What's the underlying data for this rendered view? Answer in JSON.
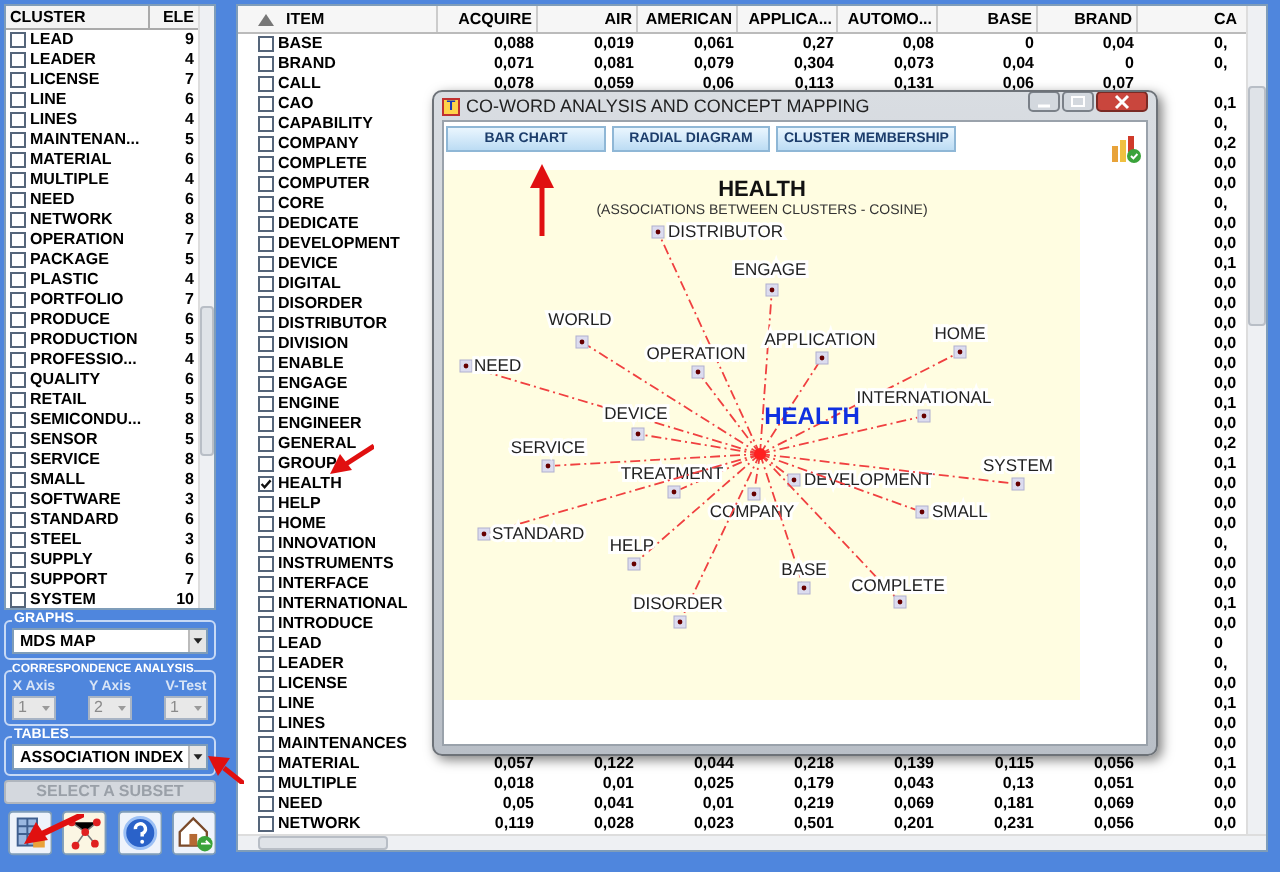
{
  "cluster_list": {
    "columns": [
      "CLUSTER",
      "ELE"
    ],
    "items": [
      {
        "label": "LEAD",
        "count": "9",
        "checked": false
      },
      {
        "label": "LEADER",
        "count": "4",
        "checked": false
      },
      {
        "label": "LICENSE",
        "count": "7",
        "checked": false
      },
      {
        "label": "LINE",
        "count": "6",
        "checked": false
      },
      {
        "label": "LINES",
        "count": "4",
        "checked": false
      },
      {
        "label": "MAINTENAN...",
        "count": "5",
        "checked": false
      },
      {
        "label": "MATERIAL",
        "count": "6",
        "checked": false
      },
      {
        "label": "MULTIPLE",
        "count": "4",
        "checked": false
      },
      {
        "label": "NEED",
        "count": "6",
        "checked": false
      },
      {
        "label": "NETWORK",
        "count": "8",
        "checked": false
      },
      {
        "label": "OPERATION",
        "count": "7",
        "checked": false
      },
      {
        "label": "PACKAGE",
        "count": "5",
        "checked": false
      },
      {
        "label": "PLASTIC",
        "count": "4",
        "checked": false
      },
      {
        "label": "PORTFOLIO",
        "count": "7",
        "checked": false
      },
      {
        "label": "PRODUCE",
        "count": "6",
        "checked": false
      },
      {
        "label": "PRODUCTION",
        "count": "5",
        "checked": false
      },
      {
        "label": "PROFESSIO...",
        "count": "4",
        "checked": false
      },
      {
        "label": "QUALITY",
        "count": "6",
        "checked": false
      },
      {
        "label": "RETAIL",
        "count": "5",
        "checked": false
      },
      {
        "label": "SEMICONDU...",
        "count": "8",
        "checked": false
      },
      {
        "label": "SENSOR",
        "count": "5",
        "checked": false
      },
      {
        "label": "SERVICE",
        "count": "8",
        "checked": false
      },
      {
        "label": "SMALL",
        "count": "8",
        "checked": false
      },
      {
        "label": "SOFTWARE",
        "count": "3",
        "checked": false
      },
      {
        "label": "STANDARD",
        "count": "6",
        "checked": false
      },
      {
        "label": "STEEL",
        "count": "3",
        "checked": false
      },
      {
        "label": "SUPPLY",
        "count": "6",
        "checked": false
      },
      {
        "label": "SUPPORT",
        "count": "7",
        "checked": false
      },
      {
        "label": "SYSTEM",
        "count": "10",
        "checked": false
      }
    ]
  },
  "graphs": {
    "label": "GRAPHS",
    "value": "MDS MAP"
  },
  "correspondence_analysis": {
    "label": "CORRESPONDENCE ANALYSIS",
    "disabled": true,
    "fields": [
      {
        "label": "X Axis",
        "value": "1"
      },
      {
        "label": "Y Axis",
        "value": "2"
      },
      {
        "label": "V-Test",
        "value": "1"
      }
    ]
  },
  "tables": {
    "label": "TABLES",
    "value": "ASSOCIATION INDEX"
  },
  "subset_button": {
    "label": "SELECT A SUBSET",
    "disabled": true
  },
  "table": {
    "columns": [
      "ITEM",
      "ACQUIRE",
      "AIR",
      "AMERICAN",
      "APPLICA...",
      "AUTOMO...",
      "BASE",
      "BRAND",
      "CA"
    ],
    "rows": [
      {
        "item": "BASE",
        "checked": false,
        "values": [
          "0,088",
          "0,019",
          "0,061",
          "0,27",
          "0,08",
          "0",
          "0,04"
        ],
        "ca": "0,"
      },
      {
        "item": "BRAND",
        "checked": false,
        "values": [
          "0,071",
          "0,081",
          "0,079",
          "0,304",
          "0,073",
          "0,04",
          "0"
        ],
        "ca": "0,"
      },
      {
        "item": "CALL",
        "checked": false,
        "values": [
          "0,078",
          "0,059",
          "0,06",
          "0,113",
          "0,131",
          "0,06",
          "0,07"
        ]
      },
      {
        "item": "CAO",
        "checked": false,
        "ca": "0,1"
      },
      {
        "item": "CAPABILITY",
        "checked": false,
        "ca": "0,"
      },
      {
        "item": "COMPANY",
        "checked": false,
        "ca": "0,2"
      },
      {
        "item": "COMPLETE",
        "checked": false,
        "ca": "0,0"
      },
      {
        "item": "COMPUTER",
        "checked": false,
        "ca": "0,0"
      },
      {
        "item": "CORE",
        "checked": false,
        "ca": "0,"
      },
      {
        "item": "DEDICATE",
        "checked": false,
        "ca": "0,0"
      },
      {
        "item": "DEVELOPMENT",
        "checked": false,
        "ca": "0,0"
      },
      {
        "item": "DEVICE",
        "checked": false,
        "ca": "0,1"
      },
      {
        "item": "DIGITAL",
        "checked": false,
        "ca": "0,0"
      },
      {
        "item": "DISORDER",
        "checked": false,
        "ca": "0,0"
      },
      {
        "item": "DISTRIBUTOR",
        "checked": false,
        "ca": "0,0"
      },
      {
        "item": "DIVISION",
        "checked": false,
        "ca": "0,0"
      },
      {
        "item": "ENABLE",
        "checked": false,
        "ca": "0,0"
      },
      {
        "item": "ENGAGE",
        "checked": false,
        "ca": "0,0"
      },
      {
        "item": "ENGINE",
        "checked": false,
        "ca": "0,1"
      },
      {
        "item": "ENGINEER",
        "checked": false,
        "ca": "0,0"
      },
      {
        "item": "GENERAL",
        "checked": false,
        "ca": "0,2"
      },
      {
        "item": "GROUP",
        "checked": false,
        "ca": "0,1"
      },
      {
        "item": "HEALTH",
        "checked": true,
        "ca": "0,0"
      },
      {
        "item": "HELP",
        "checked": false,
        "ca": "0,0"
      },
      {
        "item": "HOME",
        "checked": false,
        "ca": "0,0"
      },
      {
        "item": "INNOVATION",
        "checked": false,
        "ca": "0,"
      },
      {
        "item": "INSTRUMENTS",
        "checked": false,
        "ca": "0,0"
      },
      {
        "item": "INTERFACE",
        "checked": false,
        "ca": "0,0"
      },
      {
        "item": "INTERNATIONAL",
        "checked": false,
        "ca": "0,1"
      },
      {
        "item": "INTRODUCE",
        "checked": false,
        "ca": "0,0"
      },
      {
        "item": "LEAD",
        "checked": false,
        "ca": "0"
      },
      {
        "item": "LEADER",
        "checked": false,
        "ca": "0,"
      },
      {
        "item": "LICENSE",
        "checked": false,
        "ca": "0,0"
      },
      {
        "item": "LINE",
        "checked": false,
        "ca": "0,1"
      },
      {
        "item": "LINES",
        "checked": false,
        "ca": "0,0"
      },
      {
        "item": "MAINTENANCES",
        "checked": false,
        "ca": "0,0"
      },
      {
        "item": "MATERIAL",
        "checked": false,
        "values": [
          "0,057",
          "0,122",
          "0,044",
          "0,218",
          "0,139",
          "0,115",
          "0,056"
        ],
        "ca": "0,1"
      },
      {
        "item": "MULTIPLE",
        "checked": false,
        "values": [
          "0,018",
          "0,01",
          "0,025",
          "0,179",
          "0,043",
          "0,13",
          "0,051"
        ],
        "ca": "0,0"
      },
      {
        "item": "NEED",
        "checked": false,
        "values": [
          "0,05",
          "0,041",
          "0,01",
          "0,219",
          "0,069",
          "0,181",
          "0,069"
        ],
        "ca": "0,0"
      },
      {
        "item": "NETWORK",
        "checked": false,
        "values": [
          "0,119",
          "0,028",
          "0,023",
          "0,501",
          "0,201",
          "0,231",
          "0,056"
        ],
        "ca": "0,0"
      }
    ]
  },
  "dialog": {
    "app_icon_letter": "T",
    "title": "CO-WORD ANALYSIS AND CONCEPT MAPPING",
    "tabs": [
      "BAR CHART",
      "RADIAL DIAGRAM",
      "CLUSTER MEMBERSHIP"
    ],
    "diagram": {
      "title": "HEALTH",
      "subtitle": "(ASSOCIATIONS BETWEEN CLUSTERS - COSINE)",
      "center": "HEALTH",
      "nodes": [
        "DISTRIBUTOR",
        "ENGAGE",
        "WORLD",
        "NEED",
        "OPERATION",
        "APPLICATION",
        "HOME",
        "INTERNATIONAL",
        "DEVICE",
        "SERVICE",
        "TREATMENT",
        "DEVELOPMENT",
        "SYSTEM",
        "COMPANY",
        "SMALL",
        "STANDARD",
        "HELP",
        "BASE",
        "COMPLETE",
        "DISORDER"
      ]
    }
  }
}
